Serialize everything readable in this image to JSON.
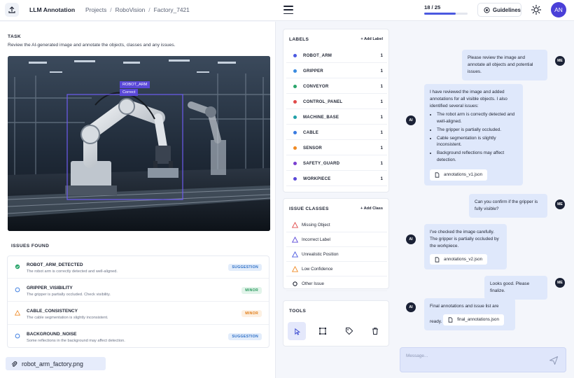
{
  "header": {
    "app_title": "LLM Annotation",
    "breadcrumb": [
      "Projects",
      "RoboVision",
      "Factory_7421"
    ],
    "progress_text": "18 / 25",
    "progress_fraction": 0.72,
    "guidelines_label": "Guidelines",
    "avatar": "AN",
    "accent": "#4b59e0"
  },
  "task": {
    "title": "TASK",
    "text": "Review the AI-generated image and annotate the objects, classes and any issues."
  },
  "image": {
    "bbox_label": "ROBOT_ARM",
    "bbox_status": "Correct",
    "file_name": "robot_arm_factory.png"
  },
  "issues": {
    "title": "ISSUES FOUND",
    "items": [
      {
        "name": "ROBOT_ARM_DETECTED",
        "desc": "The robot arm is correctly detected and well-aligned.",
        "badge": "SUGGESTION",
        "icon": "check-circle-icon"
      },
      {
        "name": "GRIPPER_VISIBILITY",
        "desc": "The gripper is partially occluded. Check visibility.",
        "badge": "MINOR",
        "icon": "info-circle-icon"
      },
      {
        "name": "CABLE_CONSISTENCY",
        "desc": "The cable segmentation is slightly inconsistent.",
        "badge": "MINOR",
        "icon": "warning-icon"
      },
      {
        "name": "BACKGROUND_NOISE",
        "desc": "Some reflections in the background may affect detection.",
        "badge": "SUGGESTION",
        "icon": "info-circle-icon"
      }
    ]
  },
  "labels": {
    "title": "LABELS",
    "add": "+ Add Label",
    "items": [
      {
        "name": "ROBOT_ARM",
        "count": "1",
        "color": "#4b59e0"
      },
      {
        "name": "GRIPPER",
        "count": "1",
        "color": "#3a8be0"
      },
      {
        "name": "CONVEYOR",
        "count": "1",
        "color": "#2aa56b"
      },
      {
        "name": "CONTROL_PANEL",
        "count": "1",
        "color": "#e14b4b"
      },
      {
        "name": "MACHINE_BASE",
        "count": "1",
        "color": "#21a0a8"
      },
      {
        "name": "CABLE",
        "count": "1",
        "color": "#3a7be0"
      },
      {
        "name": "SENSOR",
        "count": "1",
        "color": "#f08a24"
      },
      {
        "name": "SAFETY_GUARD",
        "count": "1",
        "color": "#7a3fd0"
      },
      {
        "name": "WORKPIECE",
        "count": "1",
        "color": "#5a48d8"
      }
    ]
  },
  "issue_classes": {
    "title": "ISSUE CLASSES",
    "add": "+ Add Class",
    "items": [
      {
        "name": "Missing Object",
        "icon": "warning-icon",
        "color": "#e14b4b"
      },
      {
        "name": "Incorrect Label",
        "icon": "warning-icon",
        "color": "#5a48d8"
      },
      {
        "name": "Unrealistic Position",
        "icon": "warning-icon",
        "color": "#4b59e0"
      },
      {
        "name": "Low Confidence",
        "icon": "warning-icon",
        "color": "#f08a24"
      },
      {
        "name": "Other Issue",
        "icon": "circle-icon",
        "color": "#1f2433"
      }
    ]
  },
  "tools": {
    "title": "TOOLS",
    "items": [
      "cursor-icon",
      "bbox-icon",
      "tag-icon",
      "trash-icon"
    ]
  },
  "chat": {
    "user_avatar": "ME",
    "ai_avatar": "AI",
    "messages": [
      {
        "from": "user",
        "text": "Please review the image and annotate all objects and potential issues."
      },
      {
        "from": "ai",
        "text": "I have reviewed the image and added annotations for all visible objects. I also identified several issues:",
        "bullets": [
          "The robot arm is correctly detected and well-aligned.",
          "The gripper is partially occluded.",
          "Cable segmentation is slightly inconsistent.",
          "Background reflections may affect detection."
        ],
        "attachment": "annotations_v1.json"
      },
      {
        "from": "user",
        "text": "Can you confirm if the gripper is fully visible?"
      },
      {
        "from": "ai",
        "text": "I've checked the image carefully. The gripper is partially occluded by the workpiece.",
        "attachment": "annotations_v2.json"
      },
      {
        "from": "user",
        "text": "Looks good. Please finalize."
      },
      {
        "from": "ai",
        "text": "Final annotations and issue list are ready.",
        "attachment": "final_annotations.json"
      }
    ],
    "input_placeholder": "Message..."
  }
}
